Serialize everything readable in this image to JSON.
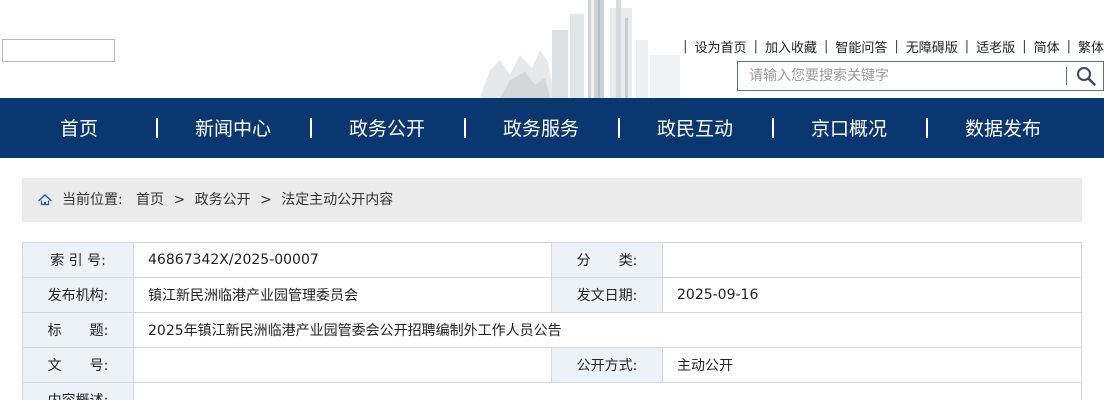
{
  "header": {
    "top_links": [
      "设为首页",
      "加入收藏",
      "智能问答",
      "无障碍版",
      "适老版",
      "简体",
      "繁体"
    ],
    "search_placeholder": "请输入您要搜索关键字"
  },
  "nav": {
    "items": [
      "首页",
      "新闻中心",
      "政务公开",
      "政务服务",
      "政民互动",
      "京口概况",
      "数据发布"
    ]
  },
  "breadcrumb": {
    "label": "当前位置:",
    "items": [
      "首页",
      "政务公开",
      "法定主动公开内容"
    ],
    "sep": ">"
  },
  "info": {
    "index_label": "索 引 号:",
    "index_value": "46867342X/2025-00007",
    "category_label": "分　　类:",
    "category_value": "",
    "publisher_label": "发布机构:",
    "publisher_value": "镇江新民洲临港产业园管理委员会",
    "date_label": "发文日期:",
    "date_value": "2025-09-16",
    "title_label": "标　　题:",
    "title_value": "2025年镇江新民洲临港产业园管委会公开招聘编制外工作人员公告",
    "docno_label": "文　　号:",
    "docno_value": "",
    "method_label": "公开方式:",
    "method_value": "主动公开",
    "summary_label": "内容概述:",
    "summary_value": ""
  },
  "colors": {
    "nav_bg": "#0b3770",
    "label_bg": "#edf1f8",
    "crumb_bg": "#ebebeb"
  }
}
